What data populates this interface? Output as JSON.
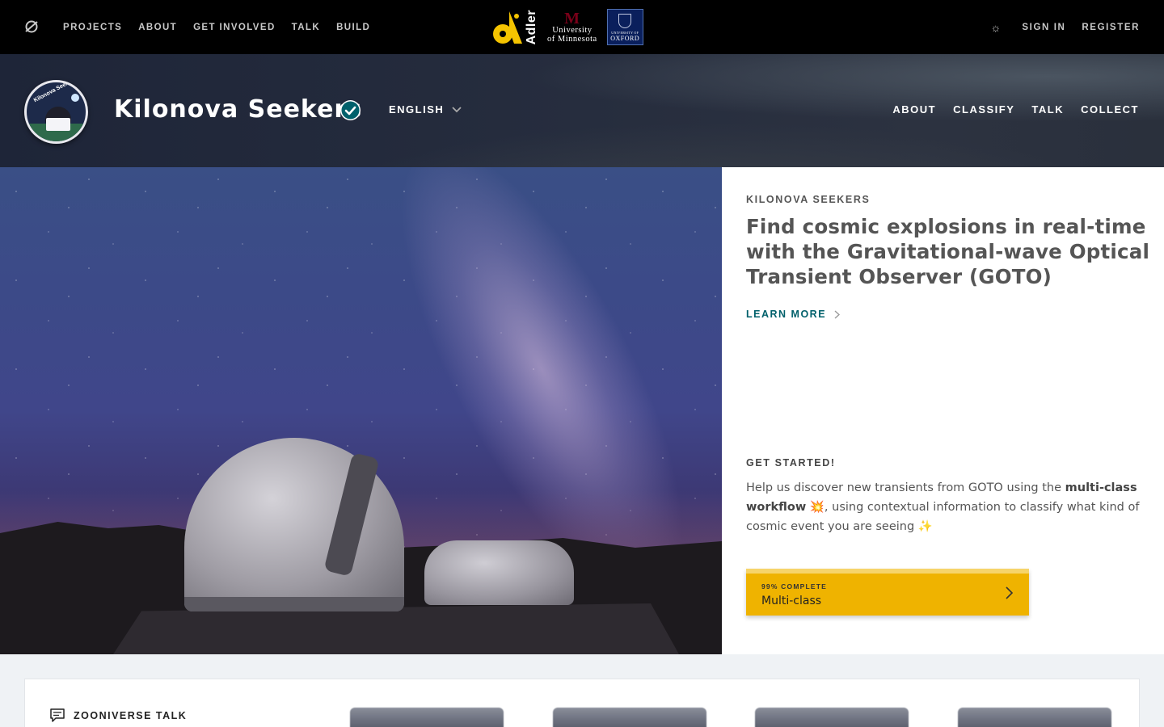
{
  "topnav": {
    "links": [
      "PROJECTS",
      "ABOUT",
      "GET INVOLVED",
      "TALK",
      "BUILD"
    ],
    "partners": {
      "adler": "Adler",
      "umn_line1": "University",
      "umn_line2": "of Minnesota",
      "oxford_small": "UNIVERSITY OF",
      "oxford_big": "OXFORD"
    },
    "sign_in": "SIGN IN",
    "register": "REGISTER",
    "theme_icon": "sun-icon"
  },
  "project": {
    "avatar_text": "Kilonova Seekers",
    "title": "Kilonova Seekers",
    "language": "ENGLISH",
    "nav": [
      "ABOUT",
      "CLASSIFY",
      "TALK",
      "COLLECT"
    ]
  },
  "hero": {
    "eyebrow": "KILONOVA SEEKERS",
    "title": "Find cosmic explosions in real-time with the Gravitational-wave Optical Transient Observer (GOTO)",
    "learn_more": "LEARN MORE",
    "get_started": "GET STARTED!",
    "desc_part1": "Help us discover new transients from GOTO using the ",
    "desc_bold": "multi-class workflow",
    "desc_part2": " 💥, using contextual information to classify what kind of cosmic event you are seeing ✨",
    "workflow": {
      "percent_label": "99% COMPLETE",
      "progress": 0.99,
      "name": "Multi-class"
    }
  },
  "bottom": {
    "talk_label": "ZOONIVERSE TALK"
  },
  "colors": {
    "accent_teal": "#00606b",
    "workflow_yellow": "#efb300",
    "topbar": "#000000"
  }
}
